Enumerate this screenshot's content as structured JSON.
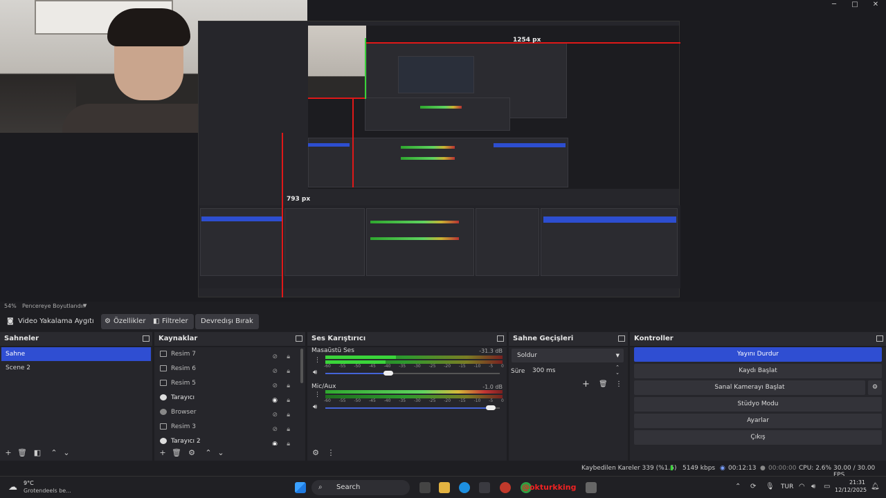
{
  "preview": {
    "nested_width_label": "1254 px",
    "nested_height_label": "793 px"
  },
  "window_controls": {
    "minimize": "─",
    "maximize": "□",
    "close": "✕"
  },
  "status_line": {
    "zoom": "54%",
    "scale_mode": "Pencereye Boyutlandır"
  },
  "toolbar": {
    "source_name": "Video Yakalama Aygıtı",
    "properties": "Özellikler",
    "filters": "Filtreler",
    "deactivate": "Devredışı Bırak"
  },
  "scenes": {
    "title": "Sahneler",
    "items": [
      {
        "label": "Sahne",
        "selected": true
      },
      {
        "label": "Scene 2",
        "selected": false
      }
    ]
  },
  "sources": {
    "title": "Kaynaklar",
    "items": [
      {
        "label": "Resim 7",
        "icon": "image-icon",
        "visible": false
      },
      {
        "label": "Resim 6",
        "icon": "image-icon",
        "visible": false
      },
      {
        "label": "Resim 5",
        "icon": "image-icon",
        "visible": false
      },
      {
        "label": "Tarayıcı",
        "icon": "globe-icon",
        "visible": true
      },
      {
        "label": "Browser",
        "icon": "globe-icon",
        "visible": false
      },
      {
        "label": "Resim 3",
        "icon": "image-icon",
        "visible": false
      },
      {
        "label": "Tarayıcı 2",
        "icon": "globe-icon",
        "visible": true
      }
    ]
  },
  "mixer": {
    "title": "Ses Karıştırıcı",
    "channels": [
      {
        "name": "Masaüstü Ses",
        "db": "-31.3 dB",
        "level_fraction": 0.4,
        "volume_fraction": 0.36
      },
      {
        "name": "Mic/Aux",
        "db": "-1.0 dB",
        "level_fraction": 0.0,
        "volume_fraction": 0.95
      }
    ],
    "scale": [
      "-60",
      "-55",
      "-50",
      "-45",
      "-40",
      "-35",
      "-30",
      "-25",
      "-20",
      "-15",
      "-10",
      "-5",
      "0"
    ]
  },
  "transitions": {
    "title": "Sahne Geçişleri",
    "selected": "Soldur",
    "duration_label": "Süre",
    "duration_value": "300 ms"
  },
  "controls": {
    "title": "Kontroller",
    "stop_stream": "Yayını Durdur",
    "start_recording": "Kaydı Başlat",
    "start_virtual_camera": "Sanal Kamerayı Başlat",
    "studio_mode": "Stüdyo Modu",
    "settings": "Ayarlar",
    "exit": "Çıkış"
  },
  "status_bar": {
    "dropped_frames": "Kaybedilen Kareler 339 (%1.5)",
    "bitrate": "5149 kbps",
    "stream_time": "00:12:13",
    "record_time": "00:00:00",
    "cpu": "CPU: 2.6%",
    "fps": "30.00 / 30.00 FPS"
  },
  "taskbar": {
    "weather_temp": "9°C",
    "weather_desc": "Grotendeels be...",
    "search": "Search",
    "language": "TUR",
    "time": "21:31",
    "date": "12/12/2025",
    "app_overlay_text": "@okturkking"
  },
  "colors": {
    "accent": "#2f4ed2",
    "panel": "#26262b",
    "title": "#2a2a2f",
    "red_guide": "#e01818"
  }
}
